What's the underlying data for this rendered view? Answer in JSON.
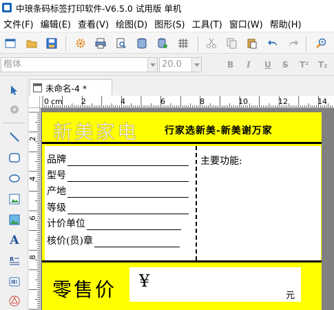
{
  "window": {
    "title": "中琅条码标签打印软件-V6.5.0 试用版 单机"
  },
  "menu": {
    "items": [
      "文件(F)",
      "编辑(E)",
      "查看(V)",
      "绘图(D)",
      "图形(S)",
      "工具(T)",
      "窗口(W)",
      "帮助(H)"
    ]
  },
  "format_toolbar": {
    "font_name": "楷体",
    "font_size": "20.0",
    "bold": "B",
    "italic": "I",
    "underline": "U",
    "strike": "S",
    "super": "T²",
    "sub": "T₂"
  },
  "document": {
    "tab_title": "未命名-4 *"
  },
  "ruler": {
    "unit": "cm",
    "h_ticks": [
      "0",
      "2",
      "4",
      "6",
      "8",
      "10",
      "12",
      "14"
    ],
    "v_ticks": [
      "2",
      "4",
      "6",
      "8"
    ]
  },
  "label": {
    "brand": "新美家电",
    "slogan": "行家选新美-新美谢万家",
    "fields": [
      "品牌",
      "型号",
      "产地",
      "等级",
      "计价单位",
      "核价(员)章"
    ],
    "function_label": "主要功能:",
    "price_title": "零售价",
    "currency_symbol": "¥",
    "currency_unit": "元"
  },
  "colors": {
    "label_background": "#ffff00",
    "app_accent": "#1a63b8"
  }
}
